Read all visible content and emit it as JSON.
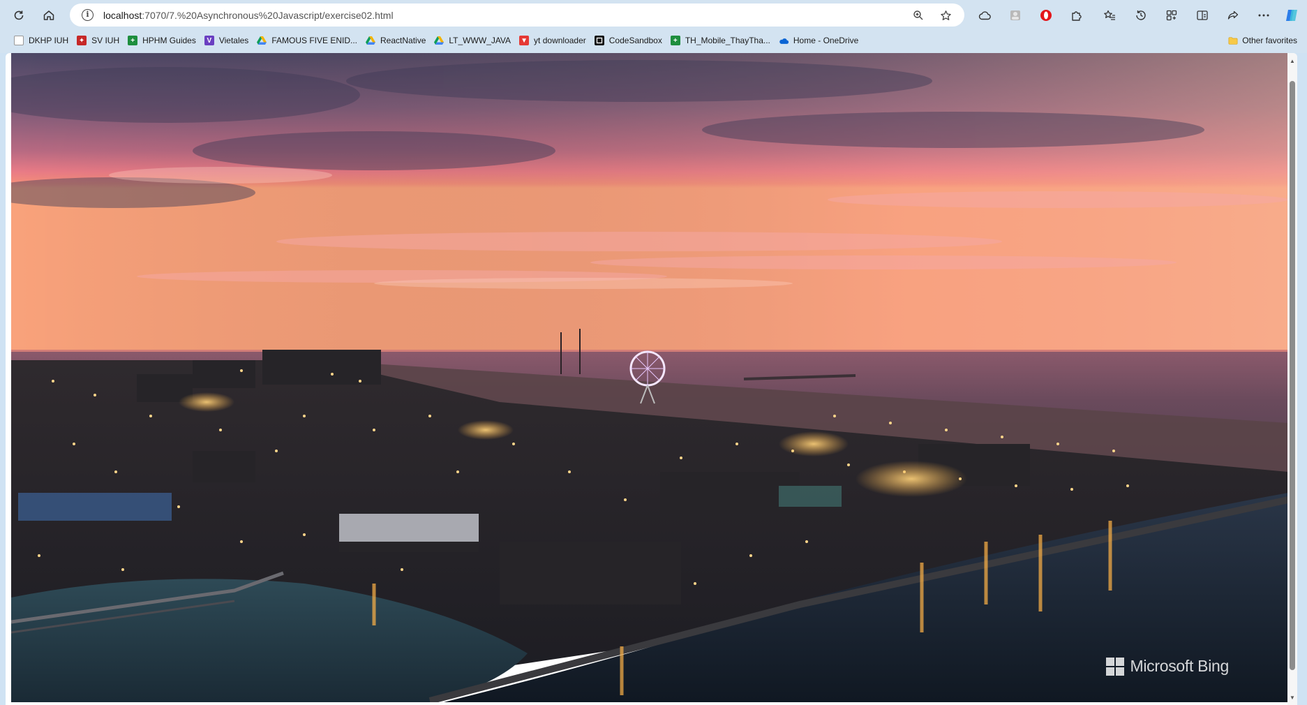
{
  "browser": {
    "url_host": "localhost",
    "url_path": ":7070/7.%20Asynchronous%20Javascript/exercise02.html",
    "bookmarks": [
      {
        "label": "DKHP IUH",
        "icon": "page-icon",
        "color": "#f5f5f5"
      },
      {
        "label": "SV IUH",
        "icon": "iuh-icon",
        "color": "#c62828"
      },
      {
        "label": "HPHM Guides",
        "icon": "sheet-icon",
        "color": "#1e8e3e"
      },
      {
        "label": "Vietales",
        "icon": "vietales-icon",
        "color": "#6a3fc1"
      },
      {
        "label": "FAMOUS FIVE ENID...",
        "icon": "drive-icon",
        "color": "#f4b400"
      },
      {
        "label": "ReactNative",
        "icon": "drive-icon",
        "color": "#0f9d58"
      },
      {
        "label": "LT_WWW_JAVA",
        "icon": "drive-icon",
        "color": "#4285f4"
      },
      {
        "label": "yt downloader",
        "icon": "download-icon",
        "color": "#e53935"
      },
      {
        "label": "CodeSandbox",
        "icon": "codesandbox-icon",
        "color": "#111111"
      },
      {
        "label": "TH_Mobile_ThayTha...",
        "icon": "sheet-icon",
        "color": "#1e8e3e"
      },
      {
        "label": "Home - OneDrive",
        "icon": "onedrive-icon",
        "color": "#0a64d4"
      }
    ],
    "other_favorites": "Other favorites"
  },
  "page": {
    "watermark": "Microsoft Bing"
  }
}
